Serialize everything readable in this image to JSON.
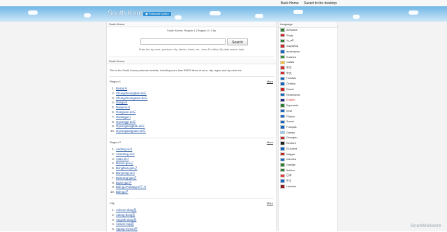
{
  "topbar": {
    "back_home": "Back Home",
    "saved": "Saved to the desktop"
  },
  "site": {
    "title": "South Korea",
    "badge": "Postcode Query"
  },
  "search_panel": {
    "header": "South Korea",
    "breadcrumb": "South Korea: Region 1 | Region 2 | City",
    "input_placeholder": "",
    "button": "Search",
    "hint": "Enter the zip code, province, city, district, street, etc., from 40 million Zip data search data"
  },
  "intro_panel": {
    "header": "South Korea",
    "text": "This is the South Korea postcode website, including more than 50625 items of area, city, region and zip code etc."
  },
  "more_label": "More",
  "region1": {
    "title": "Region 1",
    "items": [
      "Busan시",
      "Chungcheongbuk-do도",
      "Chungcheongnam-do도",
      "Daegu시",
      "Daejeon시",
      "Gangwon-do도",
      "Gwangju시",
      "Gyeonggi-do도",
      "Gyeongsangbuk-do도",
      "Gyeongsangnam-do도"
    ]
  },
  "region2": {
    "title": "Region 2",
    "items": [
      "Andong-si시",
      "Ansetong-si시",
      "Asan-si시",
      "Boeun-gun군",
      "Bonghwa-gun군",
      "Boryeong-si시",
      "Boseong-gun군",
      "Buan-gun군",
      "Buk-gu Pohang-si구 시",
      "Buk-gu구"
    ]
  },
  "city": {
    "title": "City",
    "items": [
      "Acheon-dong동",
      "Adong-dong동",
      "Aegeok-dong동",
      "Aewon-eup읍",
      "Agong-myeon면"
    ]
  },
  "sidebar": {
    "header": "Language",
    "languages": [
      {
        "label": "Afrikaans",
        "flag_color": "#2e7d32"
      },
      {
        "label": "Shqip",
        "flag_color": "#c62828"
      },
      {
        "label": "العربية",
        "flag_color": "#2e7d32"
      },
      {
        "label": "Հայերեն",
        "flag_color": "#c62828"
      },
      {
        "label": "azərbaycan",
        "flag_color": "#1565c0"
      },
      {
        "label": "Euskara",
        "flag_color": "#388e3c"
      },
      {
        "label": "Català",
        "flag_color": "#fbc02d"
      },
      {
        "label": "中文",
        "flag_color": "#d32f2f"
      },
      {
        "label": "中文",
        "flag_color": "#d32f2f"
      },
      {
        "label": "Hrvatski",
        "flag_color": "#1565c0"
      },
      {
        "label": "Čeština",
        "flag_color": "#1565c0"
      },
      {
        "label": "Dansk",
        "flag_color": "#c62828"
      },
      {
        "label": "Nederlands",
        "flag_color": "#1565c0"
      },
      {
        "label": "English",
        "flag_color": "#1a237e",
        "active": true
      },
      {
        "label": "Esperanto",
        "flag_color": "#2e7d32"
      },
      {
        "label": "eesti",
        "flag_color": "#1565c0"
      },
      {
        "label": "Filipino",
        "flag_color": "#1565c0"
      },
      {
        "label": "Suomi",
        "flag_color": "#1565c0"
      },
      {
        "label": "Français",
        "flag_color": "#1565c0"
      },
      {
        "label": "Galego",
        "flag_color": "#90caf9"
      },
      {
        "label": "Georgian",
        "flag_color": "#c62828"
      },
      {
        "label": "Deutsch",
        "flag_color": "#212121"
      },
      {
        "label": "Ελληνικά",
        "flag_color": "#1565c0"
      },
      {
        "label": "Magyar",
        "flag_color": "#c62828"
      },
      {
        "label": "íslenska",
        "flag_color": "#1565c0"
      },
      {
        "label": "Gaeilge",
        "flag_color": "#2e7d32"
      },
      {
        "label": "Italiano",
        "flag_color": "#2e7d32"
      },
      {
        "label": "日本",
        "flag_color": "#e53935"
      },
      {
        "label": "한국",
        "flag_color": "#1565c0"
      },
      {
        "label": "Latviešu",
        "flag_color": "#8e1b1b"
      }
    ]
  },
  "watermark": "ScanMalware"
}
